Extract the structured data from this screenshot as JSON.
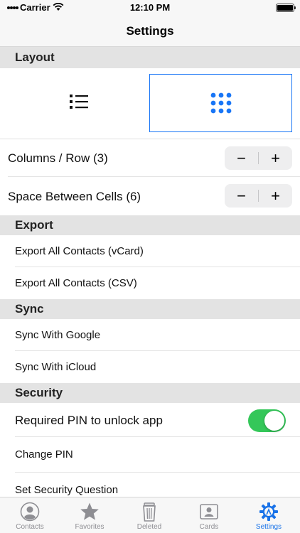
{
  "status_bar": {
    "carrier": "Carrier",
    "time": "12:10 PM"
  },
  "nav": {
    "title": "Settings"
  },
  "sections": {
    "layout": "Layout",
    "export": "Export",
    "sync": "Sync",
    "security": "Security"
  },
  "layout_options": [
    {
      "icon": "list-view-icon",
      "selected": false
    },
    {
      "icon": "grid-view-icon",
      "selected": true
    }
  ],
  "columns_row": {
    "label": "Columns / Row  (3)",
    "minus": "−",
    "plus": "+"
  },
  "space_cells": {
    "label": "Space Between Cells  (6)",
    "minus": "−",
    "plus": "+"
  },
  "export_items": [
    "Export All Contacts (vCard)",
    "Export All Contacts (CSV)"
  ],
  "sync_items": [
    "Sync With Google",
    "Sync With iCloud"
  ],
  "security_items": {
    "pin_toggle": "Required PIN to unlock app",
    "pin_toggle_on": true,
    "change_pin": "Change PIN",
    "security_question": "Set Security Question"
  },
  "tabs": [
    {
      "label": "Contacts",
      "icon": "contact-person-icon",
      "active": false
    },
    {
      "label": "Favorites",
      "icon": "star-icon",
      "active": false
    },
    {
      "label": "Deleted",
      "icon": "trash-icon",
      "active": false
    },
    {
      "label": "Cards",
      "icon": "id-card-icon",
      "active": false
    },
    {
      "label": "Settings",
      "icon": "gear-icon",
      "active": true
    }
  ],
  "colors": {
    "accent": "#1976f6",
    "toggle_on": "#34c759",
    "section_bg": "#e3e3e3"
  }
}
